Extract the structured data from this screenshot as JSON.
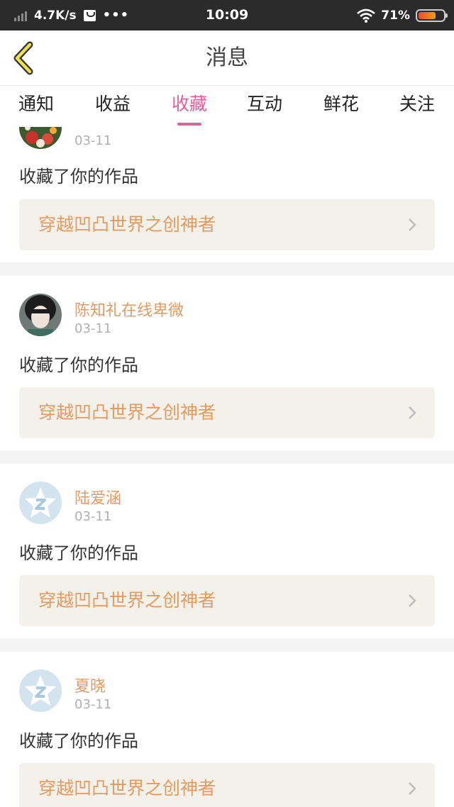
{
  "status_bar": {
    "speed": "4.7K/s",
    "dots": "•••",
    "time": "10:09",
    "battery": "71%",
    "battery_level": 0.71
  },
  "header": {
    "title": "消息",
    "back_icon": "chevron-left-icon"
  },
  "tabs": [
    {
      "label": "通知",
      "active": false
    },
    {
      "label": "收益",
      "active": false
    },
    {
      "label": "收藏",
      "active": true
    },
    {
      "label": "互动",
      "active": false
    },
    {
      "label": "鲜花",
      "active": false
    },
    {
      "label": "关注",
      "active": false
    }
  ],
  "colors": {
    "accent": "#e0609a",
    "username": "#e49a60",
    "work_bg": "#f3f1ea"
  },
  "feed": [
    {
      "user": "",
      "date": "03-11",
      "action": "收藏了你的作品",
      "work": "穿越凹凸世界之创神者",
      "avatar": "flower-photo"
    },
    {
      "user": "陈知礼在线卑微",
      "date": "03-11",
      "action": "收藏了你的作品",
      "work": "穿越凹凸世界之创神者",
      "avatar": "girl-photo"
    },
    {
      "user": "陆爱涵",
      "date": "03-11",
      "action": "收藏了你的作品",
      "work": "穿越凹凸世界之创神者",
      "avatar": "default-z-icon"
    },
    {
      "user": "夏晓",
      "date": "03-11",
      "action": "收藏了你的作品",
      "work": "穿越凹凸世界之创神者",
      "avatar": "default-z-icon"
    }
  ]
}
